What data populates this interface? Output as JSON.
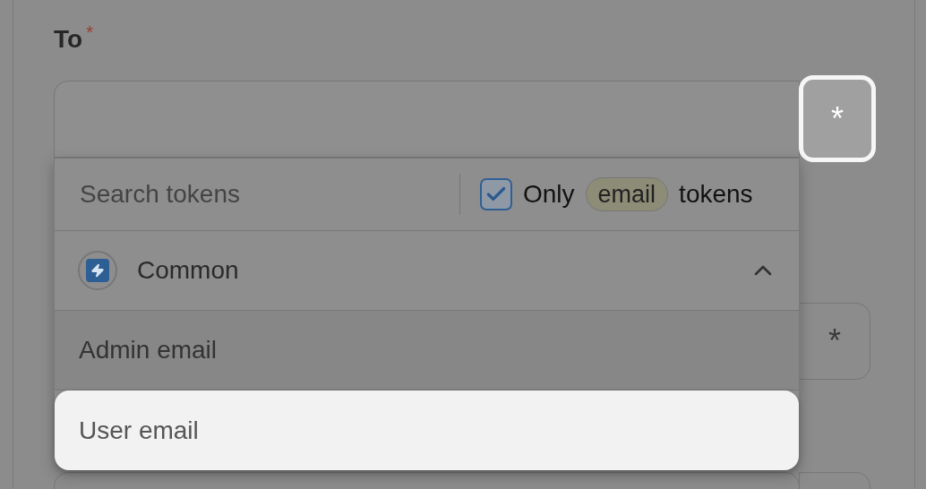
{
  "field": {
    "label": "To",
    "required_mark": "*",
    "token_button": {
      "text": "*",
      "focused": true
    }
  },
  "token_picker": {
    "search": {
      "placeholder": "Search tokens"
    },
    "filter": {
      "checked": true,
      "prefix": "Only",
      "tag": "email",
      "suffix": "tokens"
    },
    "groups": [
      {
        "name": "Common",
        "expanded": true,
        "items": [
          {
            "label": "Admin email",
            "selected": false
          },
          {
            "label": "User email",
            "selected": true
          }
        ]
      }
    ]
  },
  "background_fields": [
    {
      "token_button": "*"
    }
  ]
}
